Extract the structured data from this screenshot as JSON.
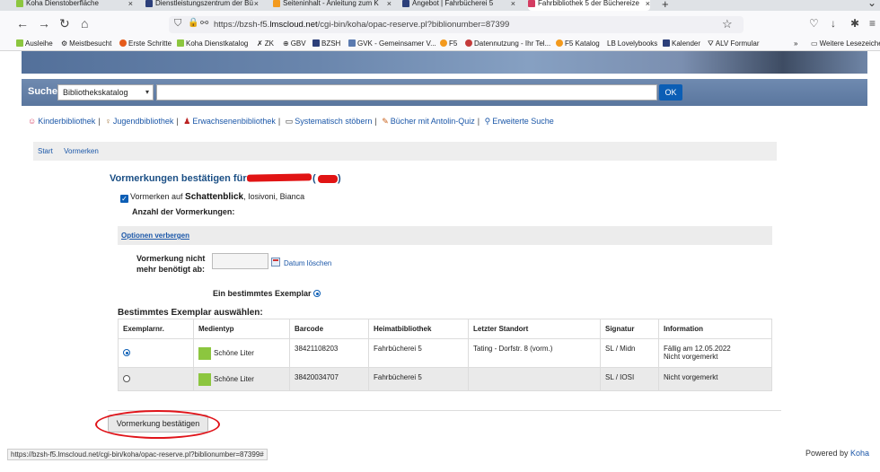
{
  "browser": {
    "tabs": [
      {
        "title": "Koha Dienstoberfläche",
        "color": "#8cc63f"
      },
      {
        "title": "Dienstleistungszentrum der Bü",
        "color": "#2c3f7a"
      },
      {
        "title": "Seiteninhalt - Anleitung zum K",
        "color": "#f39a1e"
      },
      {
        "title": "Angebot | Fahrbücherei 5",
        "color": "#2c3f7a"
      },
      {
        "title": "Fahrbibliothek 5 der Büchereize",
        "color": "#d43d62"
      }
    ],
    "url_prefix": "https://bzsh-f5.",
    "url_domain": "lmscloud.net",
    "url_path": "/cgi-bin/koha/opac-reserve.pl?biblionumber=87399",
    "bookmarks": [
      {
        "label": "Ausleihe",
        "color": "#8cc63f"
      },
      {
        "label": "Meistbesucht",
        "glyph": "⚙"
      },
      {
        "label": "Erste Schritte",
        "color": "#e55b1b"
      },
      {
        "label": "Koha Dienstkatalog",
        "color": "#8cc63f"
      },
      {
        "label": "ZK",
        "glyph": "✗"
      },
      {
        "label": "GBV",
        "glyph": "⊕"
      },
      {
        "label": "BZSH",
        "color": "#2c3f7a"
      },
      {
        "label": "GVK - Gemeinsamer V...",
        "color": "#5a7ab0"
      },
      {
        "label": "F5",
        "color": "#f39a1e"
      },
      {
        "label": "Datennutzung - Ihr Tel...",
        "color": "#c43b3b"
      },
      {
        "label": "F5 Katalog",
        "color": "#f39a1e"
      },
      {
        "label": "Lovelybooks",
        "glyph": "LB"
      },
      {
        "label": "Kalender",
        "color": "#2c3f7a"
      },
      {
        "label": "ALV Formular",
        "glyph": "⛛"
      }
    ],
    "more_bookmarks": "Weitere Lesezeichen",
    "status_url": "https://bzsh-f5.lmscloud.net/cgi-bin/koha/opac-reserve.pl?biblionumber=87399#"
  },
  "search": {
    "label": "Suche",
    "scope": "Bibliothekskatalog",
    "query": "",
    "button": "OK"
  },
  "quicklinks": [
    {
      "label": "Kinderbibliothek",
      "icon": "☺"
    },
    {
      "label": "Jugendbibliothek",
      "icon": "♀"
    },
    {
      "label": "Erwachsenenbibliothek",
      "icon": "♟"
    },
    {
      "label": "Systematisch stöbern",
      "icon": "▭"
    },
    {
      "label": "Bücher mit Antolin-Quiz",
      "icon": "✎"
    },
    {
      "label": "Erweiterte Suche",
      "icon": "⚲"
    }
  ],
  "breadcrumb": [
    "Start",
    "Vormerken"
  ],
  "reserve": {
    "heading": "Vormerkungen bestätigen für:",
    "paren_open": "(",
    "paren_close": ")",
    "line_prefix": "Vormerken auf",
    "title": "Schattenblick",
    "author": ", Iosivoni, Bianca",
    "count_label": "Anzahl der Vormerkungen:",
    "options_toggle": "Optionen verbergen",
    "not_needed_line1": "Vormerkung nicht",
    "not_needed_line2": "mehr benötigt ab:",
    "date_value": "",
    "clear_date": "Datum löschen",
    "specific_item": "Ein bestimmtes Exemplar",
    "choose_heading": "Bestimmtes Exemplar auswählen:",
    "confirm_button": "Vormerkung bestätigen"
  },
  "items_table": {
    "columns": [
      "Exemplarnr.",
      "Medientyp",
      "Barcode",
      "Heimatbibliothek",
      "Letzter Standort",
      "Signatur",
      "Information"
    ],
    "rows": [
      {
        "selected": true,
        "media": "Schöne Liter",
        "barcode": "38421108203",
        "home": "Fahrbücherei 5",
        "location": "Tating - Dorfstr. 8 (vorm.)",
        "callno": "SL / Midn",
        "info1": "Fällig am 12.05.2022",
        "info2": "Nicht vorgemerkt"
      },
      {
        "selected": false,
        "media": "Schöne Liter",
        "barcode": "38420034707",
        "home": "Fahrbücherei 5",
        "location": "",
        "callno": "SL / IOSI",
        "info1": "Nicht vorgemerkt",
        "info2": ""
      }
    ]
  },
  "footer": {
    "powered_prefix": "Powered by ",
    "powered_brand": "Koha"
  },
  "colors": {
    "accent": "#1b4f85",
    "link": "#1b57a8",
    "button_blue": "#0b5eb5",
    "annotation_red": "#e0141a"
  }
}
